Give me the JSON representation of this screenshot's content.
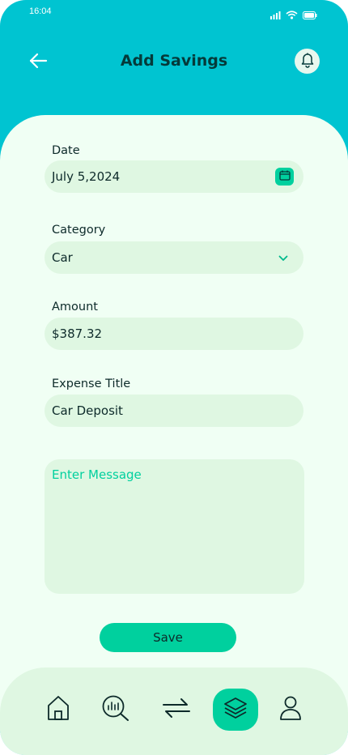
{
  "status_bar": {
    "time": "16:04"
  },
  "header": {
    "title": "Add Savings"
  },
  "form": {
    "date": {
      "label": "Date",
      "value": "July 5,2024"
    },
    "category": {
      "label": "Category",
      "value": "Car"
    },
    "amount": {
      "label": "Amount",
      "value": "$387.32"
    },
    "expense_title": {
      "label": "Expense Title",
      "value": "Car Deposit"
    },
    "message": {
      "placeholder": "Enter Message"
    },
    "save_label": "Save"
  },
  "bottom_nav": {
    "items": [
      {
        "icon": "home-icon",
        "active": false
      },
      {
        "icon": "analysis-icon",
        "active": false
      },
      {
        "icon": "transactions-icon",
        "active": false
      },
      {
        "icon": "layers-icon",
        "active": true
      },
      {
        "icon": "profile-icon",
        "active": false
      }
    ]
  },
  "colors": {
    "header_bg": "#00C4D1",
    "content_bg": "#F0FFF4",
    "field_bg": "#DFF7E2",
    "accent": "#00D09E",
    "text_dark": "#0d2a2a"
  }
}
